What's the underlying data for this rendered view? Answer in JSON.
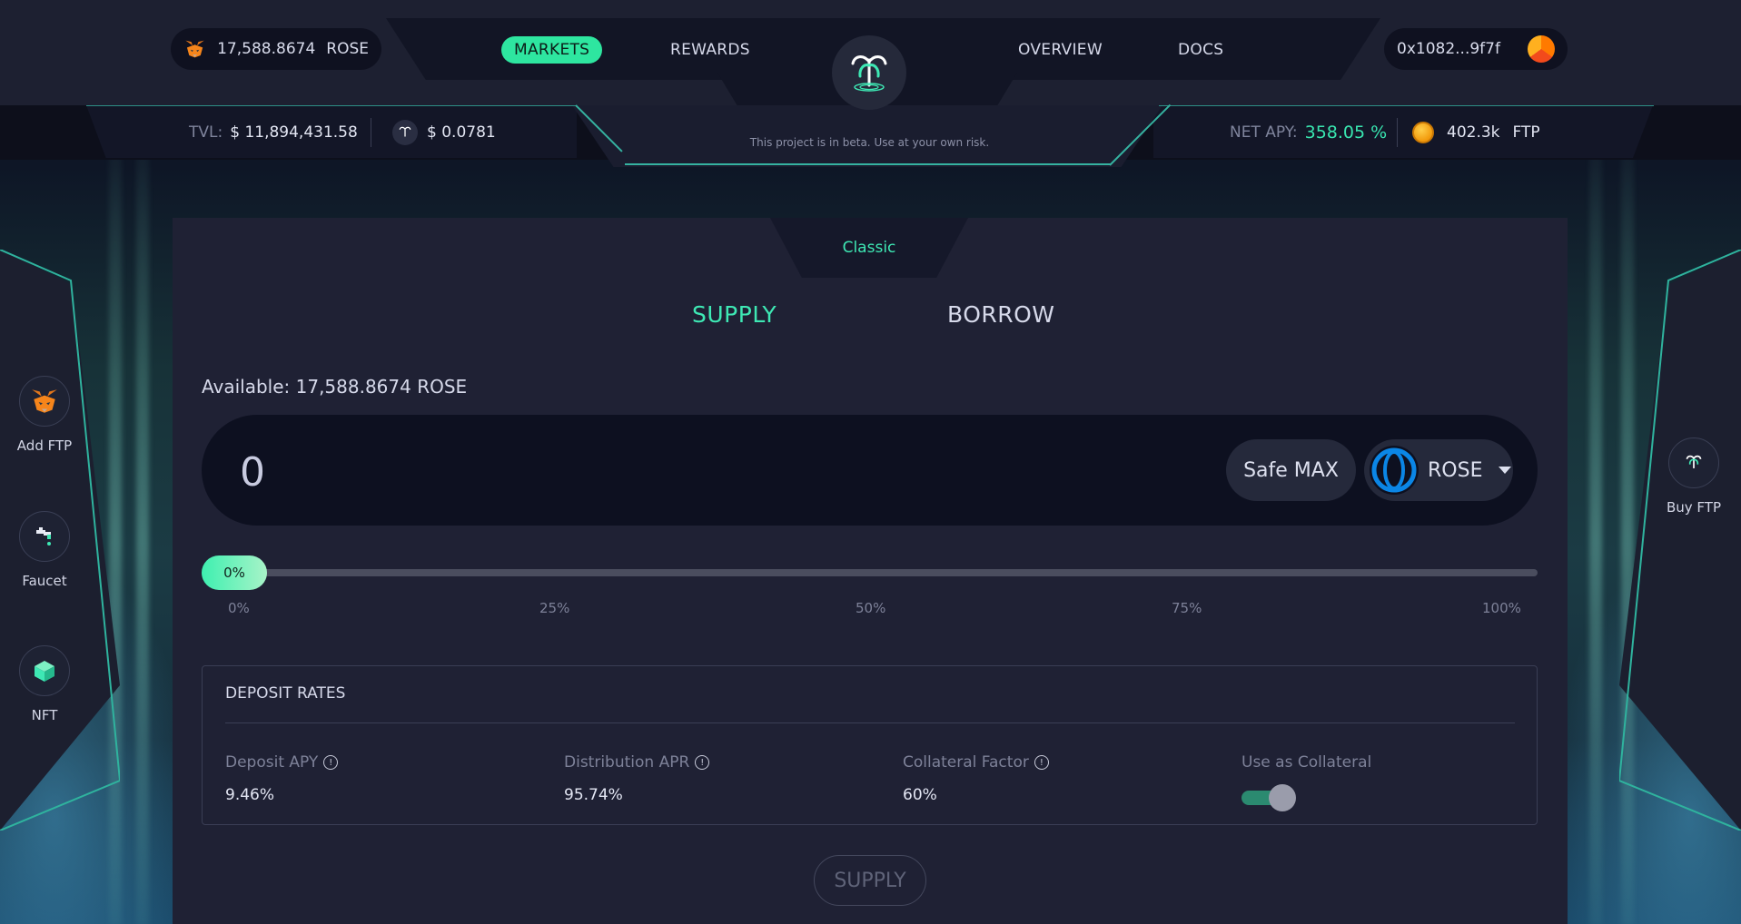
{
  "header": {
    "balance": {
      "amount": "17,588.8674",
      "token": "ROSE",
      "wallet_icon": "metamask-fox-icon"
    },
    "nav": [
      {
        "label": "MARKETS",
        "active": true
      },
      {
        "label": "REWARDS",
        "active": false
      },
      {
        "label": "OVERVIEW",
        "active": false
      },
      {
        "label": "DOCS",
        "active": false
      }
    ],
    "logo_icon": "fountain-logo-icon",
    "wallet": {
      "address": "0x1082...9f7f",
      "avatar_icon": "wallet-avatar-icon"
    },
    "beta_notice": "This project is in beta. Use at your own risk."
  },
  "stats": {
    "tvl_label": "TVL:",
    "tvl_value": "$ 11,894,431.58",
    "price_value": "$ 0.0781",
    "net_apy_label": "NET APY:",
    "net_apy_value": "358.05 %",
    "ftp_amount": "402.3k",
    "ftp_token": "FTP"
  },
  "sidebar_left": [
    {
      "label": "Add FTP",
      "icon": "metamask-fox-icon"
    },
    {
      "label": "Faucet",
      "icon": "faucet-tap-icon"
    },
    {
      "label": "NFT",
      "icon": "nft-cube-icon"
    }
  ],
  "sidebar_right": [
    {
      "label": "Buy FTP",
      "icon": "fountain-logo-icon"
    }
  ],
  "main": {
    "mode_tab": "Classic",
    "tabs": [
      {
        "label": "SUPPLY",
        "active": true
      },
      {
        "label": "BORROW",
        "active": false
      }
    ],
    "available_label": "Available: 17,588.8674 ROSE",
    "amount_value": "0",
    "safe_max_label": "Safe MAX",
    "token_selected": "ROSE",
    "slider": {
      "value_label": "0%",
      "percent": 0,
      "ticks": [
        "0%",
        "25%",
        "50%",
        "75%",
        "100%"
      ]
    },
    "deposit_rates": {
      "title": "DEPOSIT RATES",
      "items": [
        {
          "label": "Deposit APY",
          "value": "9.46%",
          "info": true
        },
        {
          "label": "Distribution APR",
          "value": "95.74%",
          "info": true
        },
        {
          "label": "Collateral Factor",
          "value": "60%",
          "info": true
        },
        {
          "label": "Use as Collateral",
          "toggle_on": true,
          "info": false
        }
      ]
    },
    "submit_label": "SUPPLY"
  },
  "colors": {
    "accent": "#3ee8b4",
    "panel": "#1f2134",
    "input_bg": "#0d1020",
    "rose_blue": "#0b86e6"
  }
}
